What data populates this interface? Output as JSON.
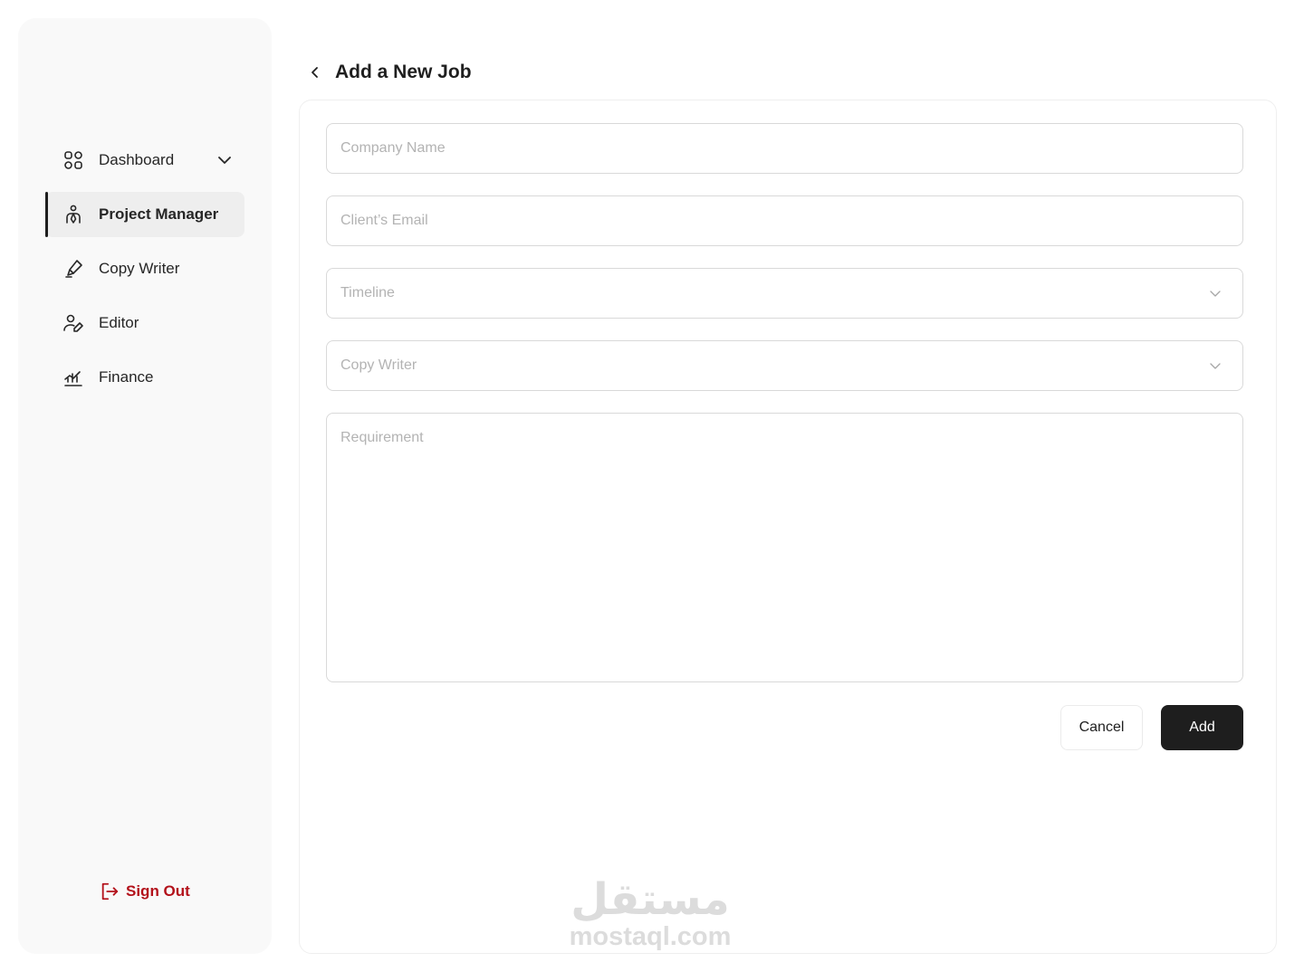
{
  "sidebar": {
    "items": [
      {
        "label": "Dashboard",
        "icon": "grid-icon",
        "has_dropdown": true
      },
      {
        "label": "Project Manager",
        "icon": "project-manager-icon",
        "active": true
      },
      {
        "label": "Copy Writer",
        "icon": "pen-icon"
      },
      {
        "label": "Editor",
        "icon": "user-edit-icon"
      },
      {
        "label": "Finance",
        "icon": "finance-chart-icon"
      }
    ],
    "signout": {
      "label": "Sign Out",
      "icon": "logout-icon",
      "color": "#b3121b"
    }
  },
  "header": {
    "title": "Add a New Job",
    "back_icon": "chevron-left-icon"
  },
  "form": {
    "company_name": {
      "placeholder": "Company Name",
      "value": ""
    },
    "client_email": {
      "placeholder": "Client’s Email",
      "value": ""
    },
    "timeline": {
      "placeholder": "Timeline",
      "icon": "chevron-down-icon"
    },
    "copy_writer": {
      "placeholder": "Copy Writer",
      "icon": "chevron-down-icon"
    },
    "requirement": {
      "placeholder": "Requirement",
      "value": ""
    }
  },
  "actions": {
    "cancel_label": "Cancel",
    "add_label": "Add"
  },
  "watermark": {
    "arabic": "مستقل",
    "latin": "mostaql.com"
  },
  "colors": {
    "accent_dark": "#1e1e1e",
    "signout_red": "#b3121b",
    "sidebar_bg": "#f9f9f9",
    "active_bg": "#eeeeee"
  }
}
